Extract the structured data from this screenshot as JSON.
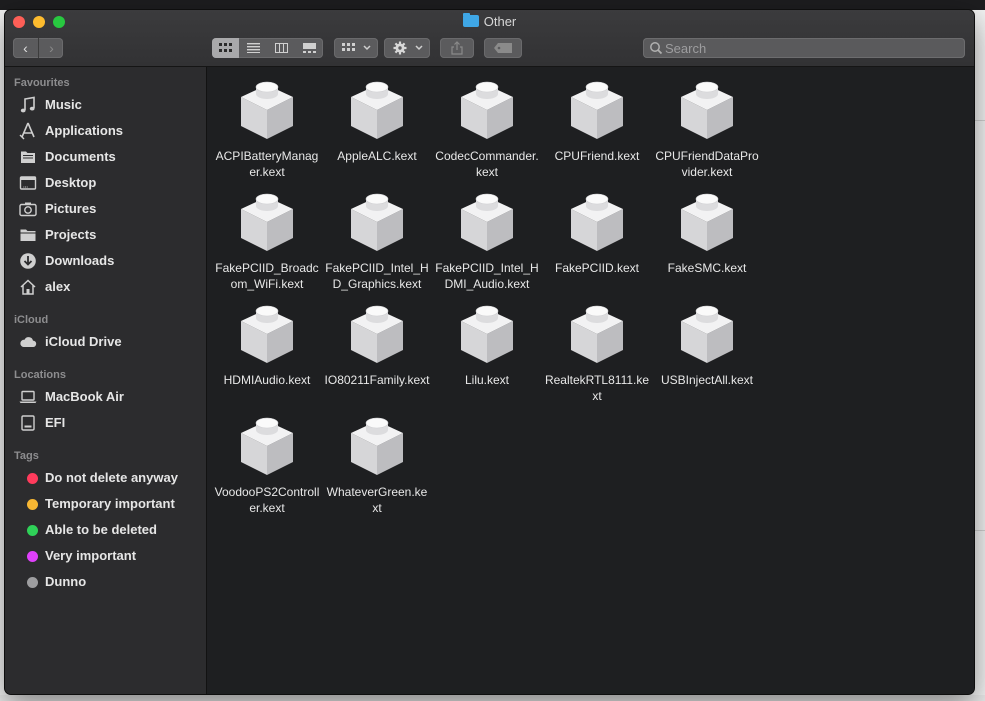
{
  "window": {
    "title": "Other"
  },
  "toolbar": {
    "back": "‹",
    "forward": "›",
    "share_glyph": "⇪",
    "search_placeholder": "Search"
  },
  "sidebar": {
    "favourites_header": "Favourites",
    "favourites": [
      {
        "label": "Music",
        "icon": "music-note-icon"
      },
      {
        "label": "Applications",
        "icon": "applications-icon"
      },
      {
        "label": "Documents",
        "icon": "documents-icon"
      },
      {
        "label": "Desktop",
        "icon": "desktop-icon"
      },
      {
        "label": "Pictures",
        "icon": "camera-icon"
      },
      {
        "label": "Projects",
        "icon": "folder-icon"
      },
      {
        "label": "Downloads",
        "icon": "download-icon"
      },
      {
        "label": "alex",
        "icon": "home-icon"
      }
    ],
    "icloud_header": "iCloud",
    "icloud": [
      {
        "label": "iCloud Drive",
        "icon": "cloud-icon"
      }
    ],
    "locations_header": "Locations",
    "locations": [
      {
        "label": "MacBook Air",
        "icon": "laptop-icon"
      },
      {
        "label": "EFI",
        "icon": "disk-icon"
      }
    ],
    "tags_header": "Tags",
    "tags": [
      {
        "label": "Do not delete anyway",
        "color": "#ff3b5c"
      },
      {
        "label": "Temporary important",
        "color": "#f7b733"
      },
      {
        "label": "Able to be deleted",
        "color": "#2fd158"
      },
      {
        "label": "Very important",
        "color": "#e040fb"
      },
      {
        "label": "Dunno",
        "color": "#9e9ea0"
      }
    ]
  },
  "files": [
    "ACPIBatteryManager.kext",
    "AppleALC.kext",
    "CodecCommander.kext",
    "CPUFriend.kext",
    "CPUFriendDataProvider.kext",
    "FakePCIID_Broadcom_WiFi.kext",
    "FakePCIID_Intel_HD_Graphics.kext",
    "FakePCIID_Intel_HDMI_Audio.kext",
    "FakePCIID.kext",
    "FakeSMC.kext",
    "HDMIAudio.kext",
    "IO80211Family.kext",
    "Lilu.kext",
    "RealtekRTL8111.kext",
    "USBInjectAll.kext",
    "VoodooPS2Controller.kext",
    "WhateverGreen.kext"
  ]
}
